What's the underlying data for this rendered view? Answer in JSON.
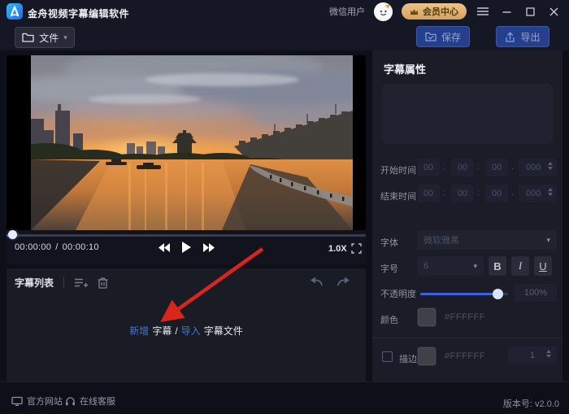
{
  "titlebar": {
    "app_title": "金舟视频字幕编辑软件",
    "user_label": "微信用户",
    "member_center_label": "会员中心"
  },
  "toolbar": {
    "file_label": "文件",
    "save_label": "保存",
    "export_label": "导出"
  },
  "player": {
    "current_time": "00:00:00",
    "time_separator": "/",
    "total_time": "00:00:10",
    "speed_label": "1.0X"
  },
  "subtitle_list": {
    "title": "字幕列表",
    "empty_hint": {
      "add_link": "新增",
      "add_suffix": "字幕",
      "slash": "/",
      "import_link": "导入",
      "import_suffix": "字幕文件"
    }
  },
  "properties": {
    "title": "字幕属性",
    "start_label": "开始时间",
    "end_label": "结束时间",
    "start": {
      "h": "00",
      "m": "00",
      "s": "00",
      "ms": "000"
    },
    "end": {
      "h": "00",
      "m": "00",
      "s": "00",
      "ms": "000"
    },
    "sep_colon": ":",
    "sep_dot": ".",
    "font_label": "字体",
    "font_value": "微软雅黑",
    "size_label": "字号",
    "size_value": "6",
    "bold_label": "B",
    "italic_label": "I",
    "underline_label": "U",
    "opacity_label": "不透明度",
    "opacity_value": "100%",
    "color_label": "颜色",
    "color_value": "#FFFFFF",
    "stroke_label": "描边",
    "stroke_color_value": "#FFFFFF",
    "stroke_width_value": "1"
  },
  "statusbar": {
    "website_label": "官方网站",
    "support_label": "在线客服",
    "version_label": "版本号: v2.0.0"
  },
  "icons": {
    "caret_down": "▾"
  },
  "colors": {
    "accent_blue": "#3e62de",
    "button_blue": "#24408d",
    "link_blue": "#4177e0",
    "member_gold": "#d9ad72",
    "arrow_red": "#d8261c",
    "panel_bg": "#1b1c28",
    "window_bg": "#0e0f18"
  }
}
